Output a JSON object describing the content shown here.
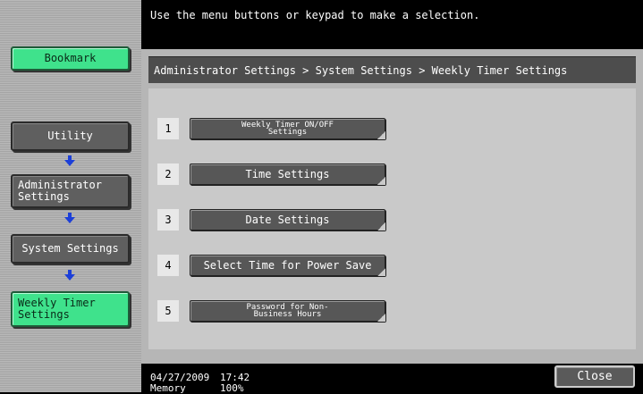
{
  "message": "Use the menu buttons or keypad to make a selection.",
  "sidebar": {
    "bookmark": "Bookmark",
    "path": [
      {
        "label": "Utility"
      },
      {
        "label": "Administrator Settings"
      },
      {
        "label": "System Settings"
      },
      {
        "label": "Weekly Timer Settings"
      }
    ]
  },
  "breadcrumb": "Administrator Settings > System Settings > Weekly Timer Settings",
  "menu": [
    {
      "num": "1",
      "label": "Weekly Timer ON/OFF Settings"
    },
    {
      "num": "2",
      "label": "Time Settings"
    },
    {
      "num": "3",
      "label": "Date Settings"
    },
    {
      "num": "4",
      "label": "Select Time for Power Save"
    },
    {
      "num": "5",
      "label": "Password for Non-Business Hours"
    }
  ],
  "footer": {
    "date": "04/27/2009",
    "time": "17:42",
    "memory_label": "Memory",
    "memory_value": "100%",
    "close": "Close"
  },
  "colors": {
    "active": "#3fe28c",
    "arrow": "#1c3fd8"
  },
  "icons": {
    "arrow": "arrow-down-icon"
  }
}
